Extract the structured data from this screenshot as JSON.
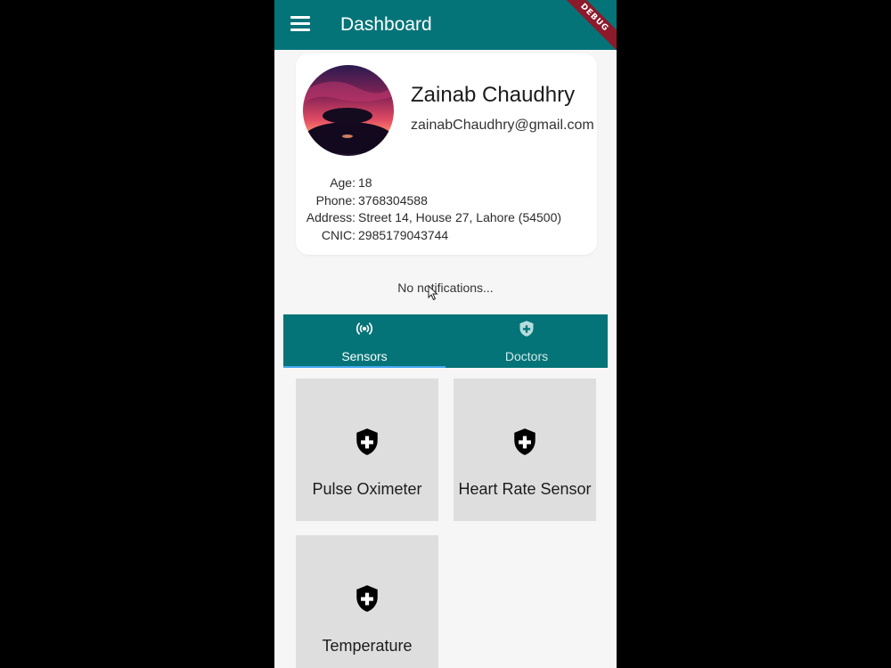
{
  "appbar": {
    "title": "Dashboard",
    "debug_banner": "DEBUG"
  },
  "profile": {
    "name": "Zainab Chaudhry",
    "email": "zainabChaudhry@gmail.com",
    "details": [
      {
        "label": "Age:",
        "value": "18"
      },
      {
        "label": "Phone:",
        "value": "3768304588"
      },
      {
        "label": "Address:",
        "value": "Street 14, House 27, Lahore (54500)"
      },
      {
        "label": "CNIC:",
        "value": "2985179043744"
      }
    ]
  },
  "notifications": {
    "text": "No notifications..."
  },
  "tabs": [
    {
      "label": "Sensors",
      "icon": "sensors-icon",
      "selected": true
    },
    {
      "label": "Doctors",
      "icon": "shield-plus-icon",
      "selected": false
    }
  ],
  "sensors": [
    {
      "label": "Pulse Oximeter",
      "icon": "shield-plus-icon"
    },
    {
      "label": "Heart Rate Sensor",
      "icon": "shield-plus-icon"
    },
    {
      "label": "Temperature",
      "icon": "shield-plus-icon"
    }
  ],
  "colors": {
    "primary": "#047478",
    "tab_indicator": "#41a6f0",
    "card_background": "#dedede",
    "debug_banner": "#8b1a2b"
  }
}
